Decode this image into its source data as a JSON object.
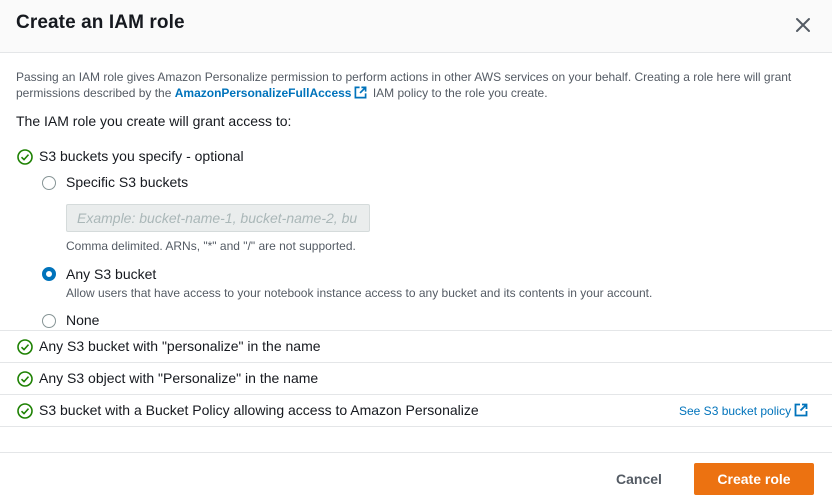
{
  "dialog": {
    "title": "Create an IAM role",
    "description_1": "Passing an IAM role gives Amazon Personalize permission to perform actions in other AWS services on your behalf. Creating a role here will grant permissions described by the ",
    "policy_link": "AmazonPersonalizeFullAccess",
    "description_2": " IAM policy to the role you create.",
    "subheading": "The IAM role you create will grant access to:"
  },
  "access": {
    "s3_buckets_label": "S3 buckets you specify - optional",
    "options": [
      {
        "label": "Specific S3 buckets",
        "selected": false
      },
      {
        "label": "Any S3 bucket",
        "selected": true,
        "description": "Allow users that have access to your notebook instance access to any bucket and its contents in your account."
      },
      {
        "label": "None",
        "selected": false
      }
    ],
    "bucket_input": {
      "placeholder": "Example: bucket-name-1, bucket-name-2, bu",
      "value": ""
    },
    "bucket_hint": "Comma delimited. ARNs, \"*\" and \"/\" are not supported.",
    "grants": [
      "Any S3 bucket with \"personalize\" in the name",
      "Any S3 object with \"Personalize\" in the name",
      "S3 bucket with a Bucket Policy allowing access to Amazon Personalize"
    ],
    "bucket_policy_link": "See S3 bucket policy"
  },
  "footer": {
    "cancel_label": "Cancel",
    "create_label": "Create role"
  },
  "colors": {
    "accent": "#0073bb",
    "primary_button": "#ec7211",
    "success": "#1d8102"
  }
}
